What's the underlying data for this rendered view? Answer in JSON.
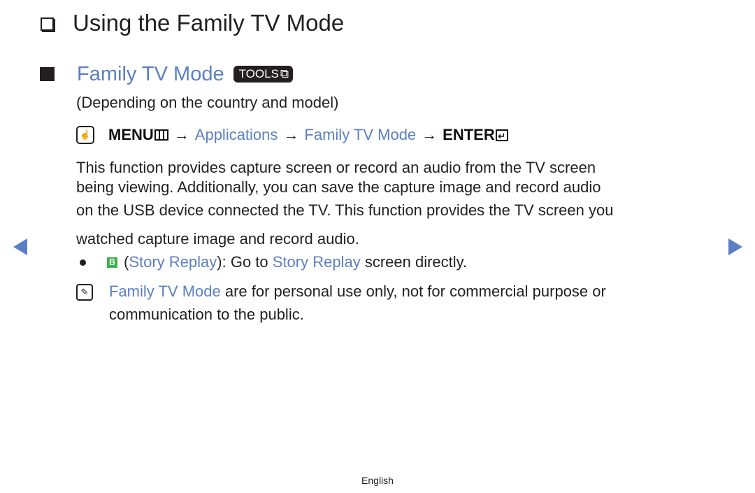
{
  "page": {
    "title": "Using the Family TV Mode",
    "section_title": "Family TV Mode",
    "tools_badge": "TOOLS",
    "condition": "(Depending on the country and model)",
    "menu_path": {
      "menu_label": "MENU",
      "arrow": "→",
      "step1": "Applications",
      "step2": "Family TV Mode",
      "enter_label": "ENTER"
    },
    "paragraph_lines": [
      "This function provides capture screen or record an audio from the TV screen",
      "being viewing. Additionally, you can save the capture image and record audio",
      "on the USB device connected the TV. This function provides the TV screen you",
      "watched capture image and record audio."
    ],
    "bullet": {
      "badge": "B",
      "open_paren": "(",
      "link1": "Story Replay",
      "middle": "): Go to ",
      "link2": "Story Replay",
      "tail": " screen directly."
    },
    "note": {
      "highlight": "Family TV Mode",
      "line1_rest": " are for personal use only, not for commercial purpose or",
      "line2": "communication to the public."
    },
    "footer": "English",
    "icons": {
      "checkbox": "❑",
      "hand": "☝",
      "enter": "↵",
      "note": "✎",
      "prev": "prev-page-arrow",
      "next": "next-page-arrow"
    },
    "colors": {
      "accent": "#5b7fc4",
      "text": "#231f20",
      "b_button": "#3cb34a"
    }
  }
}
